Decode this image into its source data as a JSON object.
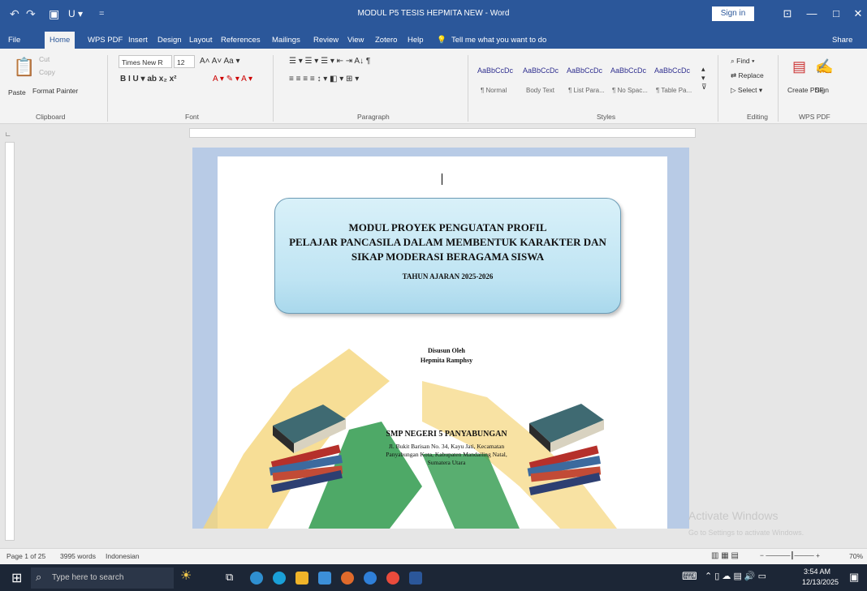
{
  "window": {
    "title": "MODUL P5 TESIS HEPMITA NEW  -  Word",
    "sign_in": "Sign in",
    "share": "Share",
    "controls": [
      "⊡",
      "—",
      "□",
      "✕"
    ]
  },
  "ribbon_tabs": [
    "File",
    "Home",
    "WPS PDF",
    "Insert",
    "Design",
    "Layout",
    "References",
    "Mailings",
    "Review",
    "View",
    "Zotero",
    "Help"
  ],
  "tell_me": "Tell me what you want to do",
  "clipboard": {
    "paste": "Paste",
    "cut": "Cut",
    "copy": "Copy",
    "format_painter": "Format Painter",
    "label": "Clipboard"
  },
  "font": {
    "name": "Times New R",
    "size": "12",
    "label": "Font"
  },
  "paragraph": {
    "label": "Paragraph"
  },
  "styles": {
    "items": [
      {
        "preview": "AaBbCcDc",
        "name": "¶ Normal"
      },
      {
        "preview": "AaBbCcDc",
        "name": "Body Text"
      },
      {
        "preview": "AaBbCcDc",
        "name": "¶ List Para..."
      },
      {
        "preview": "AaBbCcDc",
        "name": "¶ No Spac..."
      },
      {
        "preview": "AaBbCcDc",
        "name": "¶ Table Pa..."
      }
    ],
    "label": "Styles"
  },
  "editing": {
    "find": "Find",
    "replace": "Replace",
    "select": "Select",
    "label": "Editing"
  },
  "wps": {
    "create_pdf": "Create PDF",
    "sign": "Sign",
    "label": "WPS PDF"
  },
  "document": {
    "title_lines": [
      "MODUL PROYEK PENGUATAN PROFIL",
      "PELAJAR PANCASILA DALAM MEMBENTUK KARAKTER DAN",
      "SIKAP MODERASI BERAGAMA SISWA"
    ],
    "year_line": "TAHUN AJARAN 2025-2026",
    "by_label": "Disusun Oleh",
    "author": "Hepmita Ramphsy",
    "school": "SMP NEGERI 5 PANYABUNGAN",
    "address": [
      "Jl. Bukit Barisan No. 34, Kayu Jati, Kecamatan",
      "Panyabungan Kota, Kabupaten Mandailing Natal,",
      "Sumatera Utara"
    ]
  },
  "activation": {
    "title": "Activate Windows",
    "subtitle": "Go to Settings to activate Windows."
  },
  "status": {
    "page": "Page 1 of 25",
    "words": "3995 words",
    "language": "Indonesian",
    "zoom": "70%"
  },
  "taskbar": {
    "search_placeholder": "Type here to search",
    "time": "3:54 AM",
    "date": "12/13/2025"
  },
  "colors": {
    "word_blue": "#2b579a",
    "title_box": "#bfe4f3",
    "taskbar": "#1c2636"
  }
}
